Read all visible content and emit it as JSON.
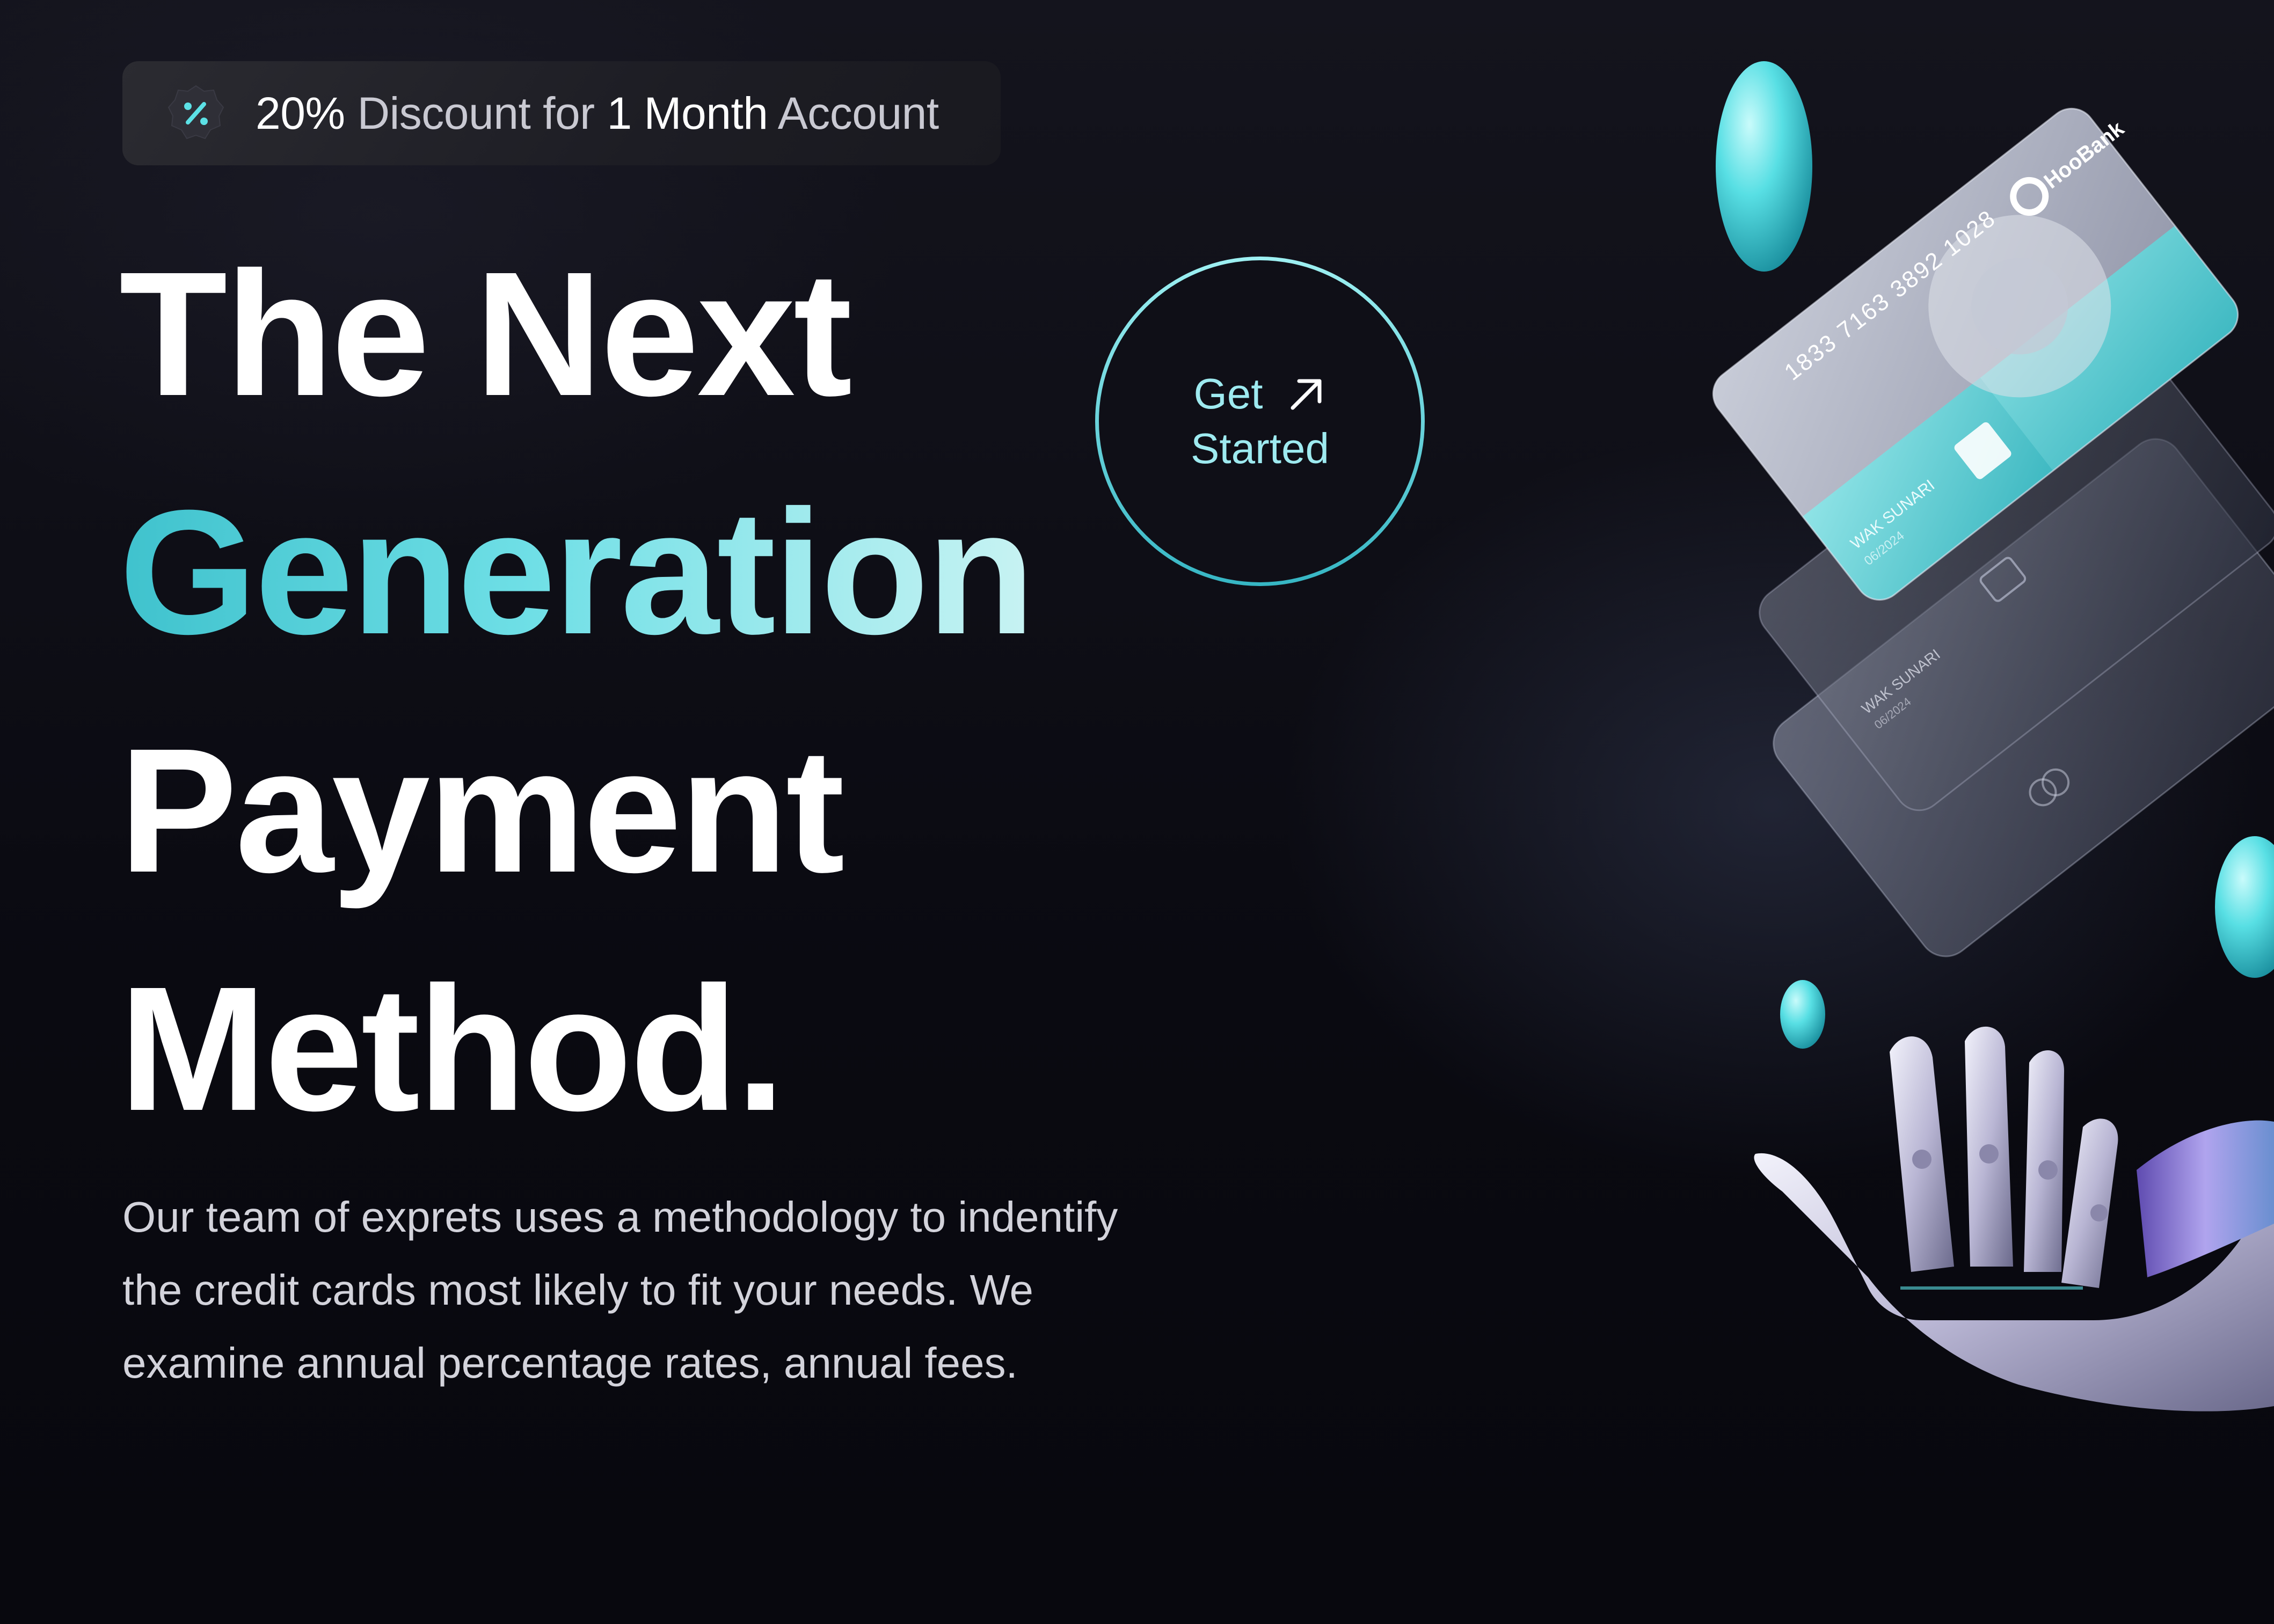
{
  "promo": {
    "icon": "discount-badge-icon",
    "parts": [
      {
        "text": "20%",
        "style": "highlight"
      },
      {
        "text": " Discount for ",
        "style": "dim"
      },
      {
        "text": "1 Month",
        "style": "highlight"
      },
      {
        "text": " Account",
        "style": "dim"
      }
    ]
  },
  "hero": {
    "title_line1": "The Next",
    "title_line2": "Generation",
    "title_line3": "Payment",
    "title_line4": "Method.",
    "cta_line1": "Get",
    "cta_line2": "Started",
    "cta_icon": "arrow-up-right-icon",
    "description": "Our team of exprets uses a methodology to indentify the credit cards most likely to fit your needs. We examine annual percentage rates, annual fees."
  },
  "card": {
    "number": "1833 7163 3892 1028",
    "brand": "HooBank",
    "holder": "WAK SUNARI",
    "expiry": "06/2024"
  },
  "colors": {
    "accent_cyan": "#5ce1e6",
    "background": "#0b0b12",
    "text_dim": "#c9c9d2",
    "white": "#ffffff"
  }
}
